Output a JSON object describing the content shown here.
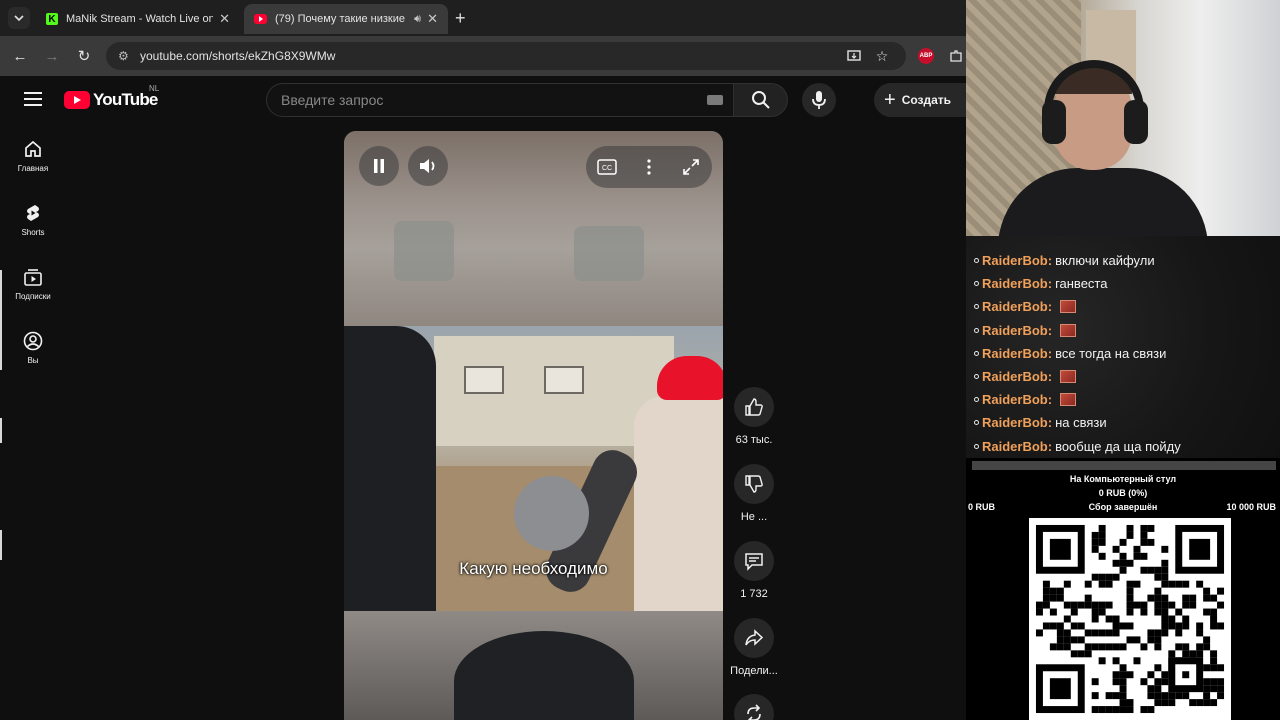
{
  "browser": {
    "tabs": [
      {
        "title": "MaNik Stream - Watch Live on K",
        "icon": "kick-icon"
      },
      {
        "title": "(79) Почему такие низкие",
        "icon": "youtube-icon",
        "active": true
      }
    ],
    "url": "youtube.com/shorts/ekZhG8X9WMw",
    "extension_badge": "ABP"
  },
  "youtube": {
    "logo_text": "YouTube",
    "region": "NL",
    "search_placeholder": "Введите запрос",
    "create_label": "Создать",
    "sidebar": [
      {
        "label": "Главная",
        "icon": "home-icon"
      },
      {
        "label": "Shorts",
        "icon": "shorts-icon"
      },
      {
        "label": "Подписки",
        "icon": "subscriptions-icon"
      },
      {
        "label": "Вы",
        "icon": "account-icon"
      }
    ],
    "video": {
      "caption": "Какую необходимо"
    },
    "actions": {
      "likes": "63 тыс.",
      "dislike_label": "Не ...",
      "comments": "1 732",
      "share_label": "Подели..."
    }
  },
  "stream_overlay": {
    "chat": [
      {
        "user": "RaiderBob:",
        "message": "включи кайфули",
        "emote": false
      },
      {
        "user": "RaiderBob:",
        "message": "ганвеста",
        "emote": false
      },
      {
        "user": "RaiderBob:",
        "message": "",
        "emote": true
      },
      {
        "user": "RaiderBob:",
        "message": "",
        "emote": true
      },
      {
        "user": "RaiderBob:",
        "message": "все тогда на связи",
        "emote": false
      },
      {
        "user": "RaiderBob:",
        "message": "",
        "emote": true
      },
      {
        "user": "RaiderBob:",
        "message": "",
        "emote": true
      },
      {
        "user": "RaiderBob:",
        "message": "на связи",
        "emote": false
      },
      {
        "user": "RaiderBob:",
        "message": "вообще да ща пойду",
        "emote": false
      }
    ],
    "donation_goal": {
      "title": "На Компьютерный стул",
      "progress_text": "0 RUB (0%)",
      "progress_fraction": 0,
      "min_label": "0 RUB",
      "status": "Сбор завершён",
      "max_label": "10 000 RUB"
    },
    "user_color": "#f0a05a"
  }
}
